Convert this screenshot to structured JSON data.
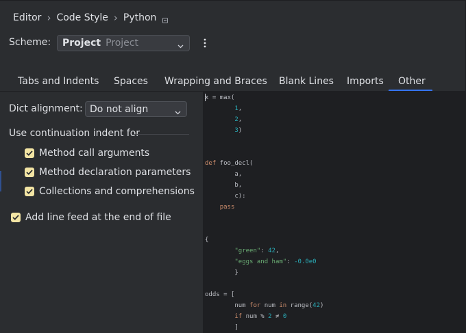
{
  "breadcrumb": {
    "items": [
      "Editor",
      "Code Style",
      "Python"
    ],
    "separator": "›"
  },
  "scheme": {
    "label": "Scheme:",
    "name": "Project",
    "sublabel": "Project"
  },
  "tabs": [
    "Tabs and Indents",
    "Spaces",
    "Wrapping and Braces",
    "Blank Lines",
    "Imports",
    "Other"
  ],
  "active_tab": "Other",
  "dict_alignment": {
    "label": "Dict alignment:",
    "value": "Do not align"
  },
  "continuation": {
    "title": "Use continuation indent for",
    "options": [
      {
        "label": "Method call arguments",
        "checked": true
      },
      {
        "label": "Method declaration parameters",
        "checked": true
      },
      {
        "label": "Collections and comprehensions",
        "checked": true
      }
    ]
  },
  "line_feed": {
    "label": "Add line feed at the end of file",
    "checked": true
  },
  "code_lines": [
    [
      [
        "x = max(",
        "p"
      ]
    ],
    [
      [
        "        ",
        "p"
      ],
      [
        "1",
        "n"
      ],
      [
        ",",
        "p"
      ]
    ],
    [
      [
        "        ",
        "p"
      ],
      [
        "2",
        "n"
      ],
      [
        ",",
        "p"
      ]
    ],
    [
      [
        "        ",
        "p"
      ],
      [
        "3",
        "n"
      ],
      [
        ")",
        "p"
      ]
    ],
    [],
    [],
    [
      [
        "def",
        "k"
      ],
      [
        " foo_decl(",
        "p"
      ]
    ],
    [
      [
        "        a,",
        "p"
      ]
    ],
    [
      [
        "        b,",
        "p"
      ]
    ],
    [
      [
        "        c):",
        "p"
      ]
    ],
    [
      [
        "    ",
        "p"
      ],
      [
        "pass",
        "k"
      ]
    ],
    [],
    [],
    [
      [
        "{",
        "p"
      ]
    ],
    [
      [
        "        ",
        "p"
      ],
      [
        "\"green\"",
        "s"
      ],
      [
        ": ",
        "p"
      ],
      [
        "42",
        "n"
      ],
      [
        ",",
        "p"
      ]
    ],
    [
      [
        "        ",
        "p"
      ],
      [
        "\"eggs and ham\"",
        "s"
      ],
      [
        ": ",
        "p"
      ],
      [
        "-0.0e0",
        "n"
      ]
    ],
    [
      [
        "        }",
        "p"
      ]
    ],
    [],
    [
      [
        "odds = [",
        "p"
      ]
    ],
    [
      [
        "        num ",
        "p"
      ],
      [
        "for",
        "k"
      ],
      [
        " num ",
        "p"
      ],
      [
        "in",
        "k"
      ],
      [
        " range(",
        "p"
      ],
      [
        "42",
        "n"
      ],
      [
        ")",
        "p"
      ]
    ],
    [
      [
        "        ",
        "p"
      ],
      [
        "if",
        "k"
      ],
      [
        " num % ",
        "p"
      ],
      [
        "2",
        "n"
      ],
      [
        " ≠ ",
        "p"
      ],
      [
        "0",
        "n"
      ]
    ],
    [
      [
        "        ]",
        "p"
      ]
    ]
  ],
  "colors": {
    "accent": "#3574f0",
    "checkbox": "#f3e5a4",
    "keyword": "#cf8e6d",
    "number": "#2aacb8",
    "string": "#6aab73",
    "editor_bg": "#1e1f22",
    "panel_bg": "#2b2d30"
  }
}
